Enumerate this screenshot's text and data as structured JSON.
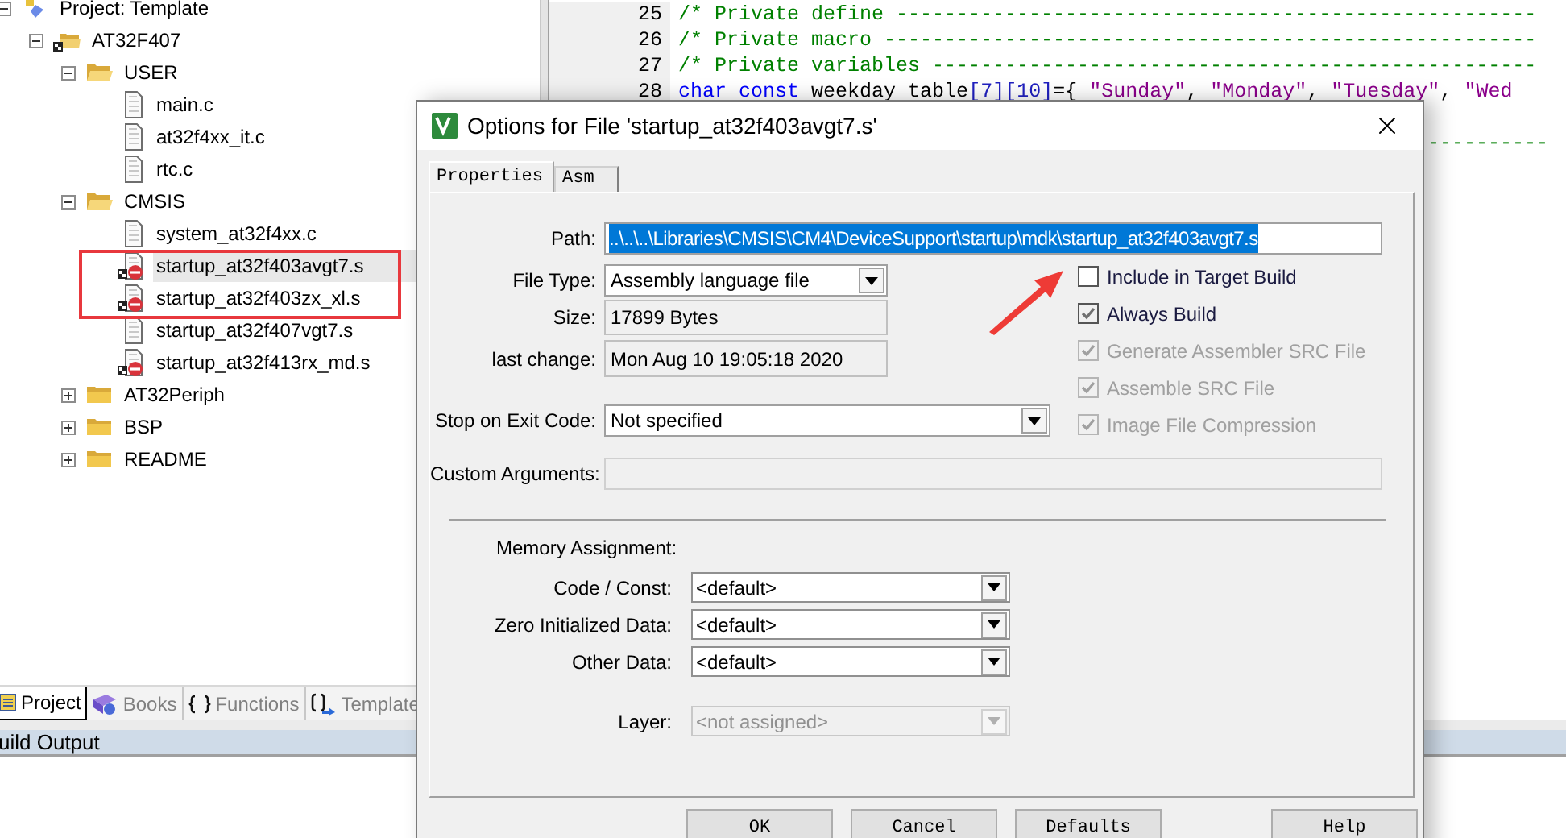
{
  "tree": [
    {
      "label": "Project: Template",
      "kind": "project",
      "expanded": true,
      "selected": false,
      "children": [
        {
          "label": "AT32F407",
          "kind": "target",
          "expanded": true,
          "selected": false,
          "children": [
            {
              "label": "USER",
              "kind": "group",
              "expanded": true,
              "selected": false,
              "children": [
                {
                  "label": "main.c",
                  "kind": "file",
                  "excluded": false,
                  "selected": false
                },
                {
                  "label": "at32f4xx_it.c",
                  "kind": "file",
                  "excluded": false,
                  "selected": false
                },
                {
                  "label": "rtc.c",
                  "kind": "file",
                  "excluded": false,
                  "selected": false
                }
              ]
            },
            {
              "label": "CMSIS",
              "kind": "group",
              "expanded": true,
              "selected": false,
              "children": [
                {
                  "label": "system_at32f4xx.c",
                  "kind": "file",
                  "excluded": false,
                  "selected": false
                },
                {
                  "label": "startup_at32f403avgt7.s",
                  "kind": "file",
                  "excluded": true,
                  "selected": true
                },
                {
                  "label": "startup_at32f403zx_xl.s",
                  "kind": "file",
                  "excluded": true,
                  "selected": false
                },
                {
                  "label": "startup_at32f407vgt7.s",
                  "kind": "file",
                  "excluded": false,
                  "selected": false
                },
                {
                  "label": "startup_at32f413rx_md.s",
                  "kind": "file",
                  "excluded": true,
                  "selected": false
                }
              ]
            },
            {
              "label": "AT32Periph",
              "kind": "group",
              "expanded": false,
              "selected": false
            },
            {
              "label": "BSP",
              "kind": "group",
              "expanded": false,
              "selected": false
            },
            {
              "label": "README",
              "kind": "group",
              "expanded": false,
              "selected": false
            }
          ]
        }
      ]
    }
  ],
  "bottom_tabs": [
    {
      "label": "Project",
      "kind": "project",
      "selected": true
    },
    {
      "label": "Books",
      "kind": "books",
      "selected": false
    },
    {
      "label": "Functions",
      "kind": "functions",
      "selected": false
    },
    {
      "label": "Template",
      "kind": "templates",
      "selected": false
    }
  ],
  "output_panel": {
    "title": "uild Output"
  },
  "editor": {
    "lines": [
      {
        "number": "25",
        "tokens": [
          {
            "kind": "comment",
            "text": "/* Private define -----------------------------------------------------"
          }
        ]
      },
      {
        "number": "26",
        "tokens": [
          {
            "kind": "comment",
            "text": "/* Private macro ------------------------------------------------------"
          }
        ]
      },
      {
        "number": "27",
        "tokens": [
          {
            "kind": "comment",
            "text": "/* Private variables --------------------------------------------------"
          }
        ]
      },
      {
        "number": "28",
        "tokens": [
          {
            "kind": "keyword",
            "text": "char"
          },
          {
            "kind": "keyword",
            "text": " const"
          },
          {
            "kind": "plain",
            "text": " weekday table"
          },
          {
            "kind": "number",
            "text": "[7][10]"
          },
          {
            "kind": "plain",
            "text": "={ "
          },
          {
            "kind": "string",
            "text": "\"Sunday\""
          },
          {
            "kind": "plain",
            "text": ", "
          },
          {
            "kind": "string",
            "text": "\"Monday\""
          },
          {
            "kind": "plain",
            "text": ", "
          },
          {
            "kind": "string",
            "text": "\"Tuesday\""
          },
          {
            "kind": "plain",
            "text": ", "
          },
          {
            "kind": "string",
            "text": "\"Wed"
          }
        ]
      }
    ],
    "covered_line_tail": "----------"
  },
  "dialog": {
    "title": "Options for File 'startup_at32f403avgt7.s'",
    "tabs": [
      {
        "label": "Properties",
        "selected": true
      },
      {
        "label": "Asm",
        "selected": false
      }
    ],
    "fields": [
      {
        "label": "Path:",
        "value": "..\\..\\..\\Libraries\\CMSIS\\CM4\\DeviceSupport\\startup\\mdk\\startup_at32f403avgt7.s",
        "kind": "text",
        "highlighted": true
      },
      {
        "label": "File Type:",
        "value": "Assembly language file",
        "kind": "select"
      },
      {
        "label": "Size:",
        "value": "17899 Bytes",
        "kind": "readonly"
      },
      {
        "label": "last change:",
        "value": "Mon Aug 10 19:05:18 2020",
        "kind": "readonly"
      },
      {
        "label": "Stop on Exit Code:",
        "value": "Not specified",
        "kind": "select"
      },
      {
        "label": "Custom Arguments:",
        "kind": "disabled"
      }
    ],
    "options": [
      {
        "label": "Include in Target Build",
        "checked": false,
        "disabled": false
      },
      {
        "label": "Always Build",
        "checked": true,
        "disabled": false
      },
      {
        "label": "Generate Assembler SRC File",
        "checked": true,
        "disabled": true
      },
      {
        "label": "Assemble SRC File",
        "checked": true,
        "disabled": true
      },
      {
        "label": "Image File Compression",
        "checked": true,
        "disabled": true
      }
    ],
    "memory": {
      "title": "Memory Assignment:",
      "fields": [
        {
          "label": "Code / Const:",
          "value": "<default>",
          "disabled": false
        },
        {
          "label": "Zero Initialized Data:",
          "value": "<default>",
          "disabled": false
        },
        {
          "label": "Other Data:",
          "value": "<default>",
          "disabled": false
        },
        {
          "label": "Layer:",
          "value": "<not assigned>",
          "disabled": true
        }
      ]
    },
    "buttons": [
      "OK",
      "Cancel",
      "Defaults",
      "Help"
    ]
  }
}
